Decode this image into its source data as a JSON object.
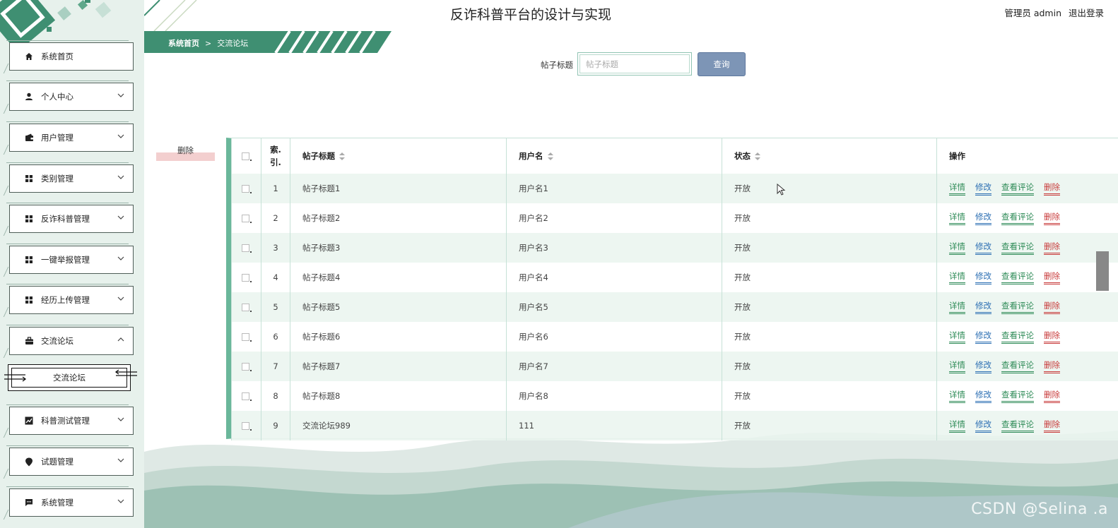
{
  "header": {
    "site_title": "反诈科普平台的设计与实现",
    "user_label": "管理员 admin",
    "logout_label": "退出登录"
  },
  "breadcrumb": {
    "home": "系统首页",
    "separator": ">",
    "current": "交流论坛"
  },
  "sidebar": {
    "items": [
      {
        "label": "系统首页",
        "icon": "home-icon"
      },
      {
        "label": "个人中心",
        "icon": "person-icon"
      },
      {
        "label": "用户管理",
        "icon": "wallet-icon"
      },
      {
        "label": "类别管理",
        "icon": "grid-icon"
      },
      {
        "label": "反诈科普管理",
        "icon": "grid-icon"
      },
      {
        "label": "一键举报管理",
        "icon": "grid-icon"
      },
      {
        "label": "经历上传管理",
        "icon": "grid-icon"
      },
      {
        "label": "交流论坛",
        "icon": "briefcase-icon"
      },
      {
        "label": "科普测试管理",
        "icon": "chart-icon"
      },
      {
        "label": "试题管理",
        "icon": "pin-icon"
      },
      {
        "label": "系统管理",
        "icon": "message-icon"
      }
    ],
    "submenu": {
      "label": "交流论坛"
    }
  },
  "search": {
    "label": "帖子标题",
    "placeholder": "帖子标题",
    "value": "",
    "button": "查询"
  },
  "batch_delete_label": "删除",
  "table": {
    "columns": {
      "index_line1": "索.",
      "index_line2": "引.",
      "title": "帖子标题",
      "username": "用户名",
      "status": "状态",
      "actions": "操作"
    },
    "actions": {
      "detail": "详情",
      "edit": "修改",
      "comments": "查看评论",
      "delete": "删除"
    },
    "rows": [
      {
        "index": "1",
        "title": "帖子标题1",
        "username": "用户名1",
        "status": "开放"
      },
      {
        "index": "2",
        "title": "帖子标题2",
        "username": "用户名2",
        "status": "开放"
      },
      {
        "index": "3",
        "title": "帖子标题3",
        "username": "用户名3",
        "status": "开放"
      },
      {
        "index": "4",
        "title": "帖子标题4",
        "username": "用户名4",
        "status": "开放"
      },
      {
        "index": "5",
        "title": "帖子标题5",
        "username": "用户名5",
        "status": "开放"
      },
      {
        "index": "6",
        "title": "帖子标题6",
        "username": "用户名6",
        "status": "开放"
      },
      {
        "index": "7",
        "title": "帖子标题7",
        "username": "用户名7",
        "status": "开放"
      },
      {
        "index": "8",
        "title": "帖子标题8",
        "username": "用户名8",
        "status": "开放"
      },
      {
        "index": "9",
        "title": "交流论坛989",
        "username": "111",
        "status": "开放"
      }
    ]
  },
  "watermark": "CSDN @Selina .a",
  "colors": {
    "accent_green": "#3f8f72",
    "sidebar_bg": "#e7f1ec",
    "search_button": "#7d95b6",
    "delete_red": "#c83a3a",
    "edit_blue": "#2c6fb3"
  }
}
